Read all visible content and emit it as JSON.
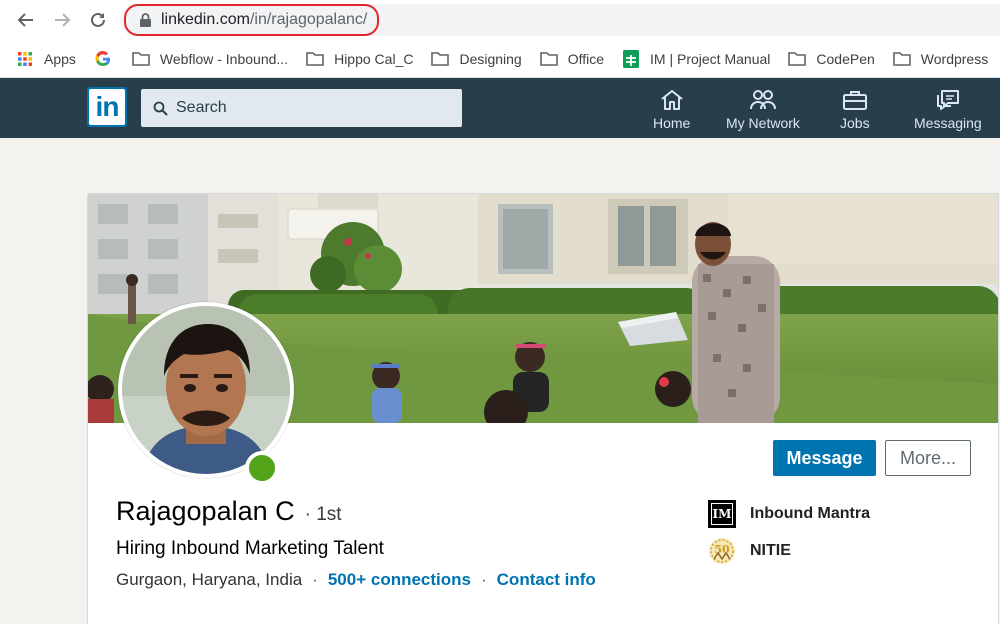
{
  "browser": {
    "url_domain": "linkedin.com",
    "url_path": "/in/rajagopalanc/",
    "bookmarks": [
      {
        "label": "Apps",
        "icon": "apps-grid-icon"
      },
      {
        "label": "",
        "icon": "google-icon"
      },
      {
        "label": "Webflow - Inbound...",
        "icon": "folder-icon"
      },
      {
        "label": "Hippo Cal_C",
        "icon": "folder-icon"
      },
      {
        "label": "Designing",
        "icon": "folder-icon"
      },
      {
        "label": "Office",
        "icon": "folder-icon"
      },
      {
        "label": "IM | Project Manual",
        "icon": "sheets-icon"
      },
      {
        "label": "CodePen",
        "icon": "folder-icon"
      },
      {
        "label": "Wordpress",
        "icon": "folder-icon"
      }
    ]
  },
  "nav": {
    "logo": "in",
    "search_placeholder": "Search",
    "items": [
      {
        "label": "Home",
        "icon": "home-icon"
      },
      {
        "label": "My Network",
        "icon": "my-network-icon"
      },
      {
        "label": "Jobs",
        "icon": "briefcase-icon"
      },
      {
        "label": "Messaging",
        "icon": "messaging-icon"
      }
    ]
  },
  "profile": {
    "name": "Rajagopalan C",
    "degree": "1st",
    "headline": "Hiring Inbound Marketing Talent",
    "location": "Gurgaon, Haryana, India",
    "connections": "500+ connections",
    "contact": "Contact info",
    "message_button": "Message",
    "more_button": "More...",
    "organizations": [
      {
        "name": "Inbound Mantra",
        "logo_text": "IM"
      },
      {
        "name": "NITIE",
        "logo_text": "50"
      }
    ]
  },
  "colors": {
    "nav_bg": "#283e4a",
    "brand_blue": "#0073b1",
    "presence_green": "#53a318",
    "url_highlight": "#e3262b"
  }
}
